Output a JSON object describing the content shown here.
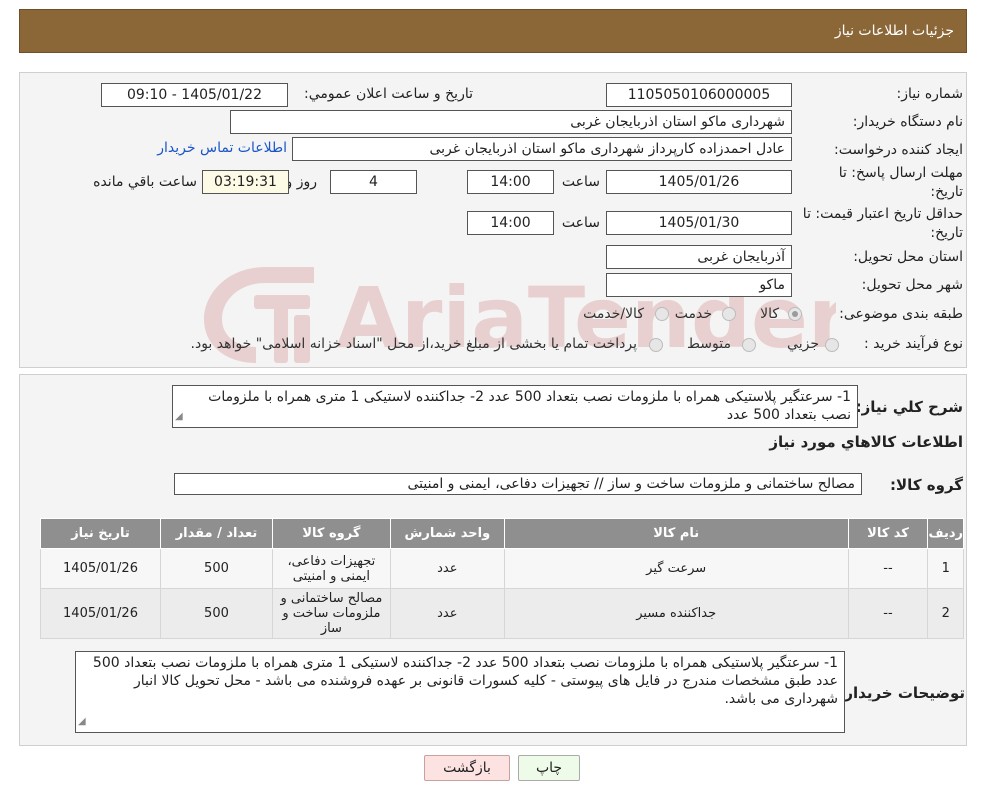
{
  "header": {
    "title": "جزئیات اطلاعات نیاز"
  },
  "form": {
    "need_number_label": "شماره نیاز:",
    "need_number": "1105050106000005",
    "announce_label": "تاریخ و ساعت اعلان عمومي:",
    "announce_value": "1405/01/22 - 09:10",
    "buyer_org_label": "نام دستگاه خريدار:",
    "buyer_org": "شهرداری ماکو استان اذربایجان غربی",
    "requester_label": "ايجاد کننده درخواست:",
    "requester": "عادل احمدزاده کارپرداز شهرداری ماکو استان اذربایجان غربی",
    "contact_link": "اطلاعات تماس خريدار",
    "deadline_label_1": "مهلت ارسال پاسخ: تا",
    "deadline_label_2": "تاریخ:",
    "deadline_date": "1405/01/26",
    "time_label": "ساعت",
    "deadline_time": "14:00",
    "days_value": "4",
    "days_label": "روز و",
    "remaining_time": "03:19:31",
    "remaining_label": "ساعت باقي مانده",
    "validity_label_1": "حداقل تاريخ اعتبار قيمت: تا",
    "validity_label_2": "تاریخ:",
    "validity_date": "1405/01/30",
    "validity_time": "14:00",
    "province_label": "استان محل تحويل:",
    "province": "آذربایجان غربی",
    "city_label": "شهر محل تحويل:",
    "city": "ماکو",
    "category_label": "طبقه بندی موضوعی:",
    "category_options": [
      "کالا",
      "خدمت",
      "کالا/خدمت"
    ],
    "process_label": "نوع فرآيند خريد :",
    "process_options": [
      "جزيي",
      "متوسط"
    ],
    "process_note": "پرداخت تمام یا بخشی از مبلغ خرید،از محل \"اسناد خزانه اسلامی\" خواهد بود."
  },
  "watermark": {
    "text": "AriaTender.neT"
  },
  "details": {
    "summary_label": "شرح کلي نياز:",
    "summary": "1- سرعتگیر پلاستیکی همراه با ملزومات نصب بتعداد 500 عدد 2- جداکننده لاستیکی 1 متری همراه با ملزومات نصب بتعداد 500 عدد",
    "goods_info_title": "اطلاعات کالاهاي مورد نياز",
    "goods_group_label": "گروه کالا:",
    "goods_group": "مصالح ساختمانی و ملزومات ساخت و ساز // تجهیزات دفاعی، ایمنی و امنیتی"
  },
  "table": {
    "headers": [
      "رديف",
      "کد کالا",
      "نام کالا",
      "واحد شمارش",
      "گروه کالا",
      "تعداد / مقدار",
      "تاريخ نياز"
    ],
    "rows": [
      {
        "idx": "1",
        "code": "--",
        "name": "سرعت گیر",
        "unit": "عدد",
        "group": "تجهیزات دفاعی، ایمنی و امنیتی",
        "qty": "500",
        "date": "1405/01/26"
      },
      {
        "idx": "2",
        "code": "--",
        "name": "جداکننده مسیر",
        "unit": "عدد",
        "group": "مصالح ساختمانی و ملزومات ساخت و ساز",
        "qty": "500",
        "date": "1405/01/26"
      }
    ]
  },
  "buyer_notes": {
    "label": "توضيحات خريدار:",
    "text": "1- سرعتگیر پلاستیکی همراه با ملزومات نصب بتعداد 500 عدد 2- جداکننده لاستیکی 1 متری همراه با ملزومات نصب بتعداد 500 عدد  طبق مشخصات مندرج در فایل های پیوستی  - کلیه کسورات قانونی بر عهده فروشنده می باشد - محل تحویل کالا انبار شهرداری می باشد."
  },
  "buttons": {
    "print": "چاپ",
    "back": "بازگشت"
  },
  "colors": {
    "header_bg": "#8b6637",
    "table_header_bg": "#8f8f8f",
    "link": "#1a56c9",
    "back_btn_bg": "#fde2e2"
  }
}
